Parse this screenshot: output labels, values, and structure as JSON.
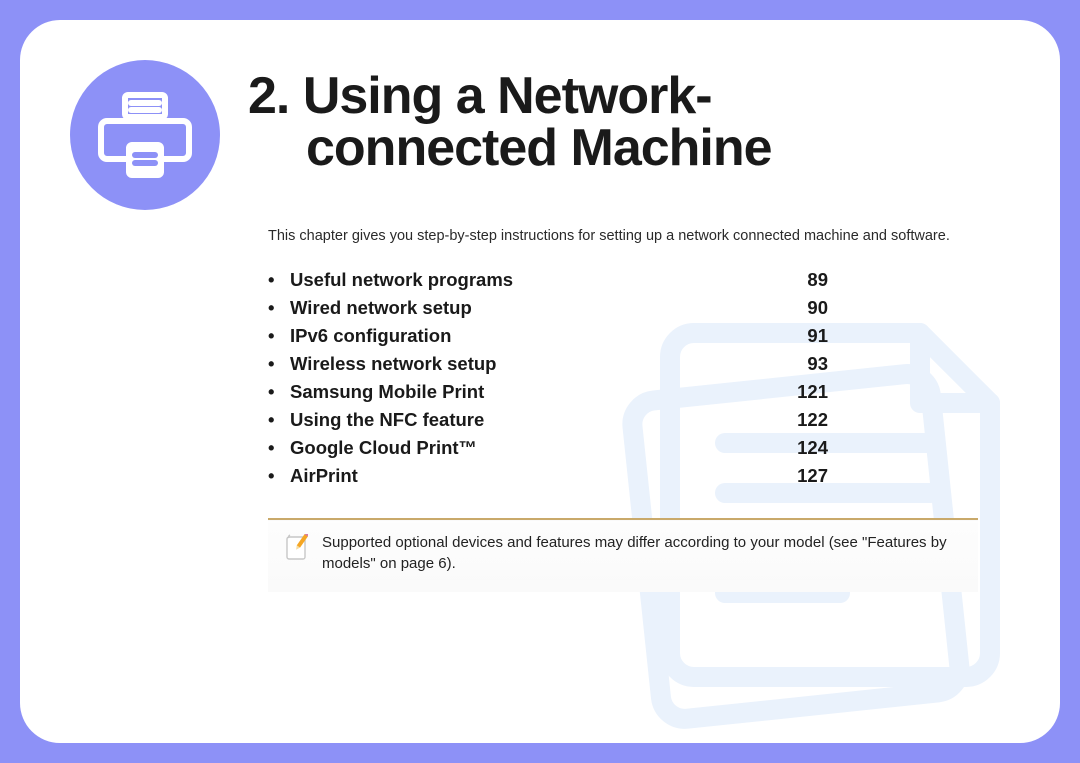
{
  "chapter": {
    "number": "2.",
    "title_line1": "Using a Network-",
    "title_line2": "connected Machine"
  },
  "intro": "This chapter gives you step-by-step instructions for setting up a network connected machine and software.",
  "toc": [
    {
      "label": "Useful network programs",
      "page": "89"
    },
    {
      "label": "Wired network setup",
      "page": "90"
    },
    {
      "label": "IPv6 configuration",
      "page": "91"
    },
    {
      "label": "Wireless network setup",
      "page": "93"
    },
    {
      "label": "Samsung Mobile Print",
      "page": "121"
    },
    {
      "label": "Using the NFC feature",
      "page": "122"
    },
    {
      "label": "Google Cloud Print™",
      "page": "124"
    },
    {
      "label": "AirPrint",
      "page": "127"
    }
  ],
  "note": "Supported optional devices and features may differ according to your model (see \"Features by models\" on page 6).",
  "icons": {
    "printer": "printer-icon",
    "note": "note-pencil-icon",
    "bg": "documents-stack-icon"
  },
  "colors": {
    "accent": "#8d91f7",
    "watermark": "#eaf2fc",
    "note_border": "#c9a96a"
  }
}
